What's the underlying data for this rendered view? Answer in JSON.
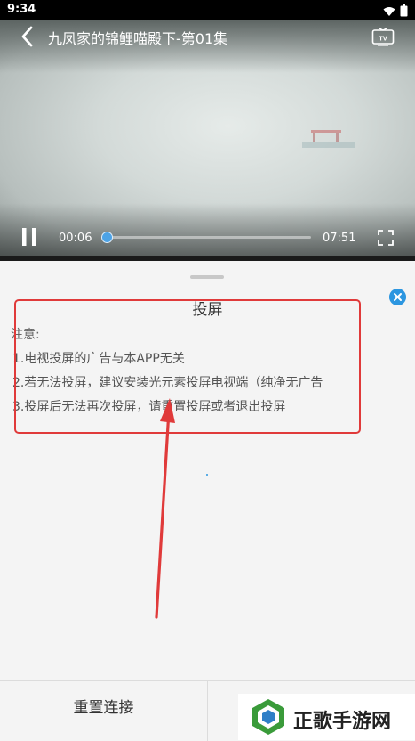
{
  "status_bar": {
    "time": "9:34"
  },
  "player": {
    "title": "九凤家的锦鲤喵殿下-第01集",
    "current_time": "00:06",
    "total_time": "07:51",
    "progress_fraction": 0.015,
    "accent_color": "#4da3e6"
  },
  "cast_sheet": {
    "title": "投屏",
    "note_heading": "注意:",
    "notes": [
      "1.电视投屏的广告与本APP无关",
      "2.若无法投屏，建议安装光元素投屏电视端（纯净无广告",
      "3.投屏后无法再次投屏，请重置投屏或者退出投屏"
    ],
    "highlight_color": "#e03a3a",
    "close_color": "#2c96e0"
  },
  "footer": {
    "reconnect_label": "重置连接"
  },
  "watermark": {
    "text": "正歌手游网"
  },
  "icons": [
    "wifi-icon",
    "battery-icon",
    "back-icon",
    "tv-cast-icon",
    "pause-icon",
    "fullscreen-icon",
    "close-icon",
    "watermark-logo-icon"
  ]
}
